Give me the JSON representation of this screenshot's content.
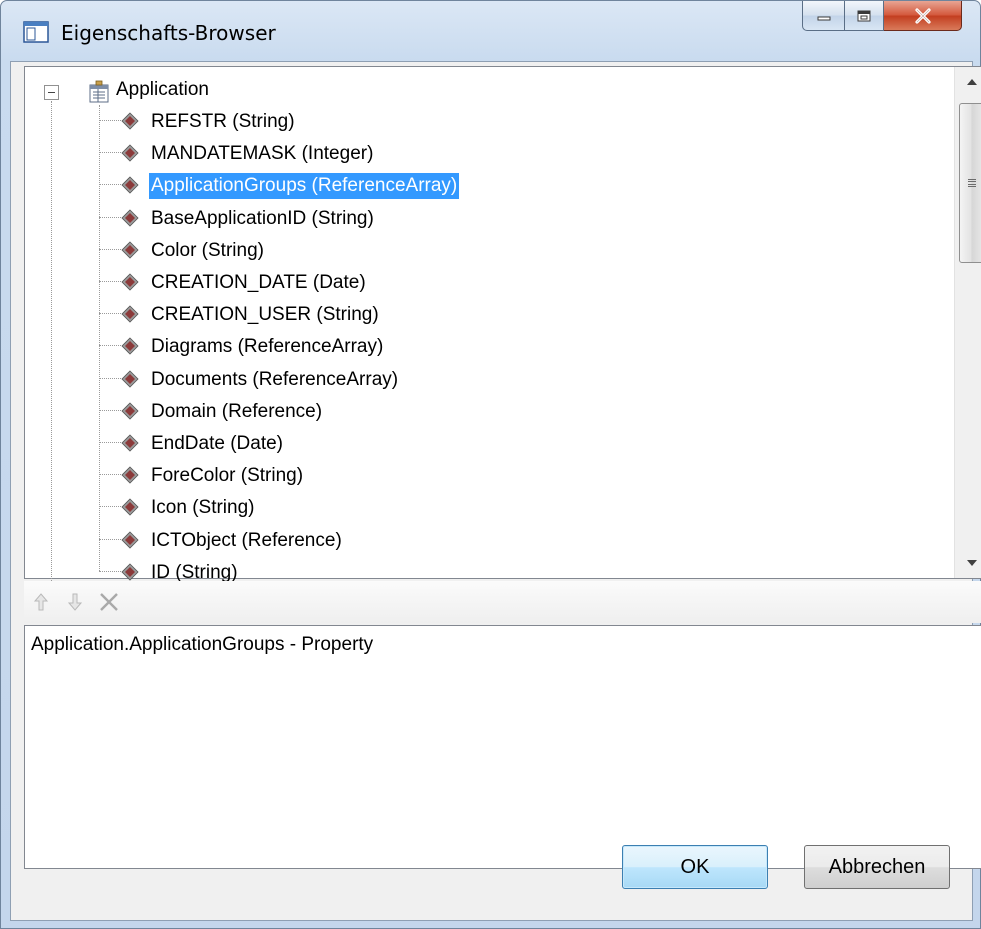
{
  "window": {
    "title": "Eigenschafts-Browser",
    "caption_buttons": [
      "minimize-icon",
      "maximize-icon",
      "close-icon"
    ]
  },
  "tree": {
    "root": {
      "label": "Application",
      "icon": "class-icon",
      "expanded": true
    },
    "items": [
      {
        "label": "REFSTR (String)",
        "icon": "property-icon",
        "selected": false
      },
      {
        "label": "MANDATEMASK (Integer)",
        "icon": "property-icon",
        "selected": false
      },
      {
        "label": "ApplicationGroups (ReferenceArray)",
        "icon": "property-icon",
        "selected": true
      },
      {
        "label": "BaseApplicationID (String)",
        "icon": "property-icon",
        "selected": false
      },
      {
        "label": "Color (String)",
        "icon": "property-icon",
        "selected": false
      },
      {
        "label": "CREATION_DATE (Date)",
        "icon": "property-icon",
        "selected": false
      },
      {
        "label": "CREATION_USER (String)",
        "icon": "property-icon",
        "selected": false
      },
      {
        "label": "Diagrams (ReferenceArray)",
        "icon": "property-icon",
        "selected": false
      },
      {
        "label": "Documents (ReferenceArray)",
        "icon": "property-icon",
        "selected": false
      },
      {
        "label": "Domain (Reference)",
        "icon": "property-icon",
        "selected": false
      },
      {
        "label": "EndDate (Date)",
        "icon": "property-icon",
        "selected": false
      },
      {
        "label": "ForeColor (String)",
        "icon": "property-icon",
        "selected": false
      },
      {
        "label": "Icon (String)",
        "icon": "property-icon",
        "selected": false
      },
      {
        "label": "ICTObject (Reference)",
        "icon": "property-icon",
        "selected": false
      },
      {
        "label": "ID (String)",
        "icon": "property-icon",
        "selected": false
      }
    ]
  },
  "toolbar": {
    "buttons": [
      {
        "icon": "arrow-up-icon",
        "enabled": false
      },
      {
        "icon": "arrow-down-icon",
        "enabled": false
      },
      {
        "icon": "delete-icon",
        "enabled": false
      }
    ]
  },
  "description": {
    "text": "Application.ApplicationGroups - Property"
  },
  "buttons": {
    "ok_label": "OK",
    "cancel_label": "Abbrechen"
  },
  "colors": {
    "selection": "#3399ff",
    "property_icon": "#8b3a3a"
  }
}
